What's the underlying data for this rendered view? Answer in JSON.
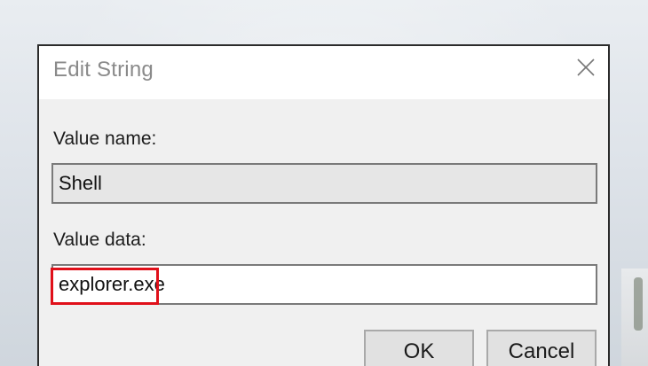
{
  "dialog": {
    "title": "Edit String",
    "close_icon": "close-icon",
    "value_name_label": "Value name:",
    "value_name": "Shell",
    "value_data_label": "Value data:",
    "value_data": "explorer.exe",
    "highlight_color": "#e0101a",
    "ok_label": "OK",
    "cancel_label": "Cancel"
  }
}
